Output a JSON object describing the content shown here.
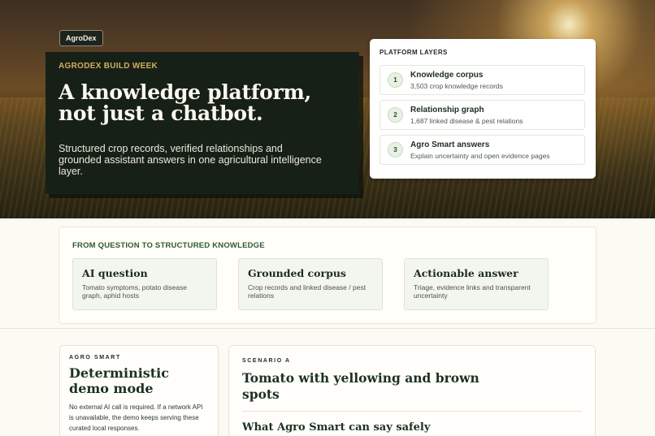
{
  "brand": {
    "name": "AgroDex"
  },
  "hero": {
    "eyebrow": "AGRODEX BUILD WEEK",
    "title_line1": "A knowledge platform,",
    "title_line2": "not just a chatbot.",
    "subtitle": "Structured crop records, verified relationships and grounded assistant answers in one agricultural intelligence layer."
  },
  "platform_layers": {
    "title": "PLATFORM LAYERS",
    "items": [
      {
        "number": "1",
        "title": "Knowledge corpus",
        "subtitle": "3,503 crop knowledge records"
      },
      {
        "number": "2",
        "title": "Relationship graph",
        "subtitle": "1,687 linked disease & pest relations"
      },
      {
        "number": "3",
        "title": "Agro Smart answers",
        "subtitle": "Explain uncertainty and open evidence pages"
      }
    ]
  },
  "flow": {
    "title": "FROM QUESTION TO STRUCTURED KNOWLEDGE",
    "cards": [
      {
        "title": "AI question",
        "subtitle": "Tomato symptoms, potato disease graph, aphid hosts"
      },
      {
        "title": "Grounded corpus",
        "subtitle": "Crop records and linked disease / pest relations"
      },
      {
        "title": "Actionable answer",
        "subtitle": "Triage, evidence links and transparent uncertainty"
      }
    ]
  },
  "demo": {
    "eyebrow": "AGRO SMART",
    "title": "Deterministic demo mode",
    "text": "No external AI call is required. If a network API is unavailable, the demo keeps serving these curated local responses."
  },
  "scenario": {
    "eyebrow": "SCENARIO A",
    "title": "Tomato with yellowing and brown spots",
    "subtitle": "What Agro Smart can say safely"
  },
  "colors": {
    "accent_green": "#2e5a31",
    "accent_gold": "#d3ad5f",
    "hero_card": "#172017",
    "page_bg": "#fbfaf3"
  }
}
